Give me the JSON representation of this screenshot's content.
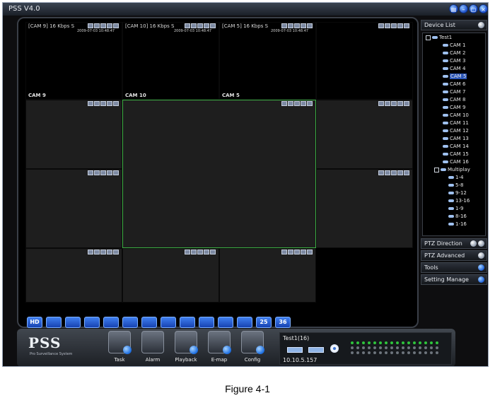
{
  "app": {
    "title": "PSS  V4.0"
  },
  "cells": [
    {
      "info": "[CAM 9]  16 Kbps S",
      "timestamp": "2009-07-03 10:48:47",
      "label": "CAM 9",
      "black": true
    },
    {
      "info": "[CAM 10]  16 Kbps S",
      "timestamp": "2009-07-03 10:48:47",
      "label": "CAM 10",
      "black": true
    },
    {
      "info": "[CAM 5]  16 Kbps S",
      "timestamp": "2009-07-03 10:48:47",
      "label": "CAM 5",
      "black": true
    },
    {
      "info": "",
      "timestamp": "",
      "label": "",
      "black": true
    },
    {
      "info": "",
      "timestamp": "",
      "label": ""
    },
    {
      "info": "",
      "timestamp": "",
      "label": "",
      "selected": true
    },
    {
      "info": "",
      "timestamp": "",
      "label": ""
    },
    {
      "info": "",
      "timestamp": "",
      "label": ""
    },
    {
      "info": "",
      "timestamp": "",
      "label": ""
    },
    {
      "info": "",
      "timestamp": "",
      "label": ""
    },
    {
      "info": "",
      "timestamp": "",
      "label": ""
    },
    {
      "info": "",
      "timestamp": "",
      "label": ""
    }
  ],
  "layout_buttons": [
    "HD",
    "",
    "",
    "",
    "",
    "",
    "",
    "",
    "",
    "",
    "",
    "",
    "25",
    "36"
  ],
  "device_list": {
    "title": "Device List",
    "group1": "Test1",
    "cams": [
      "CAM 1",
      "CAM 2",
      "CAM 3",
      "CAM 4",
      "CAM 5",
      "CAM 6",
      "CAM 7",
      "CAM 8",
      "CAM 9",
      "CAM 10",
      "CAM 11",
      "CAM 12",
      "CAM 13",
      "CAM 14",
      "CAM 15",
      "CAM 16"
    ],
    "selected": "CAM 5",
    "group2": "Multiplay",
    "multiplay": [
      "1-4",
      "5-8",
      "9-12",
      "13-16",
      "1-9",
      "8-16",
      "1-16"
    ]
  },
  "panels": [
    "PTZ Direction",
    "PTZ Advanced",
    "Tools",
    "Setting Manage"
  ],
  "toolbar": {
    "logo": "PSS",
    "logo_sub": "Pro Surveillance System",
    "tools": [
      "Task",
      "Alarm",
      "Playback",
      "E-map",
      "Config"
    ]
  },
  "device_status": {
    "name": "Test1(16)",
    "ip": "10.10.5.157",
    "channel_states": [
      1,
      1,
      1,
      1,
      1,
      1,
      1,
      1,
      1,
      1,
      1,
      1,
      1,
      1,
      1,
      1,
      0,
      0,
      0,
      0,
      0,
      0,
      0,
      0,
      0,
      0,
      0,
      0,
      0,
      0,
      0,
      0,
      0,
      0,
      0,
      0,
      0,
      0,
      0,
      0,
      0,
      0,
      0,
      0,
      0,
      0,
      0,
      0
    ]
  },
  "colors": {
    "background": "#0e0e10",
    "selected_cell_border": "#3cb043",
    "accent_blue": "#1f52c9",
    "led_green": "#2ec43c"
  },
  "caption": "Figure 4-1"
}
